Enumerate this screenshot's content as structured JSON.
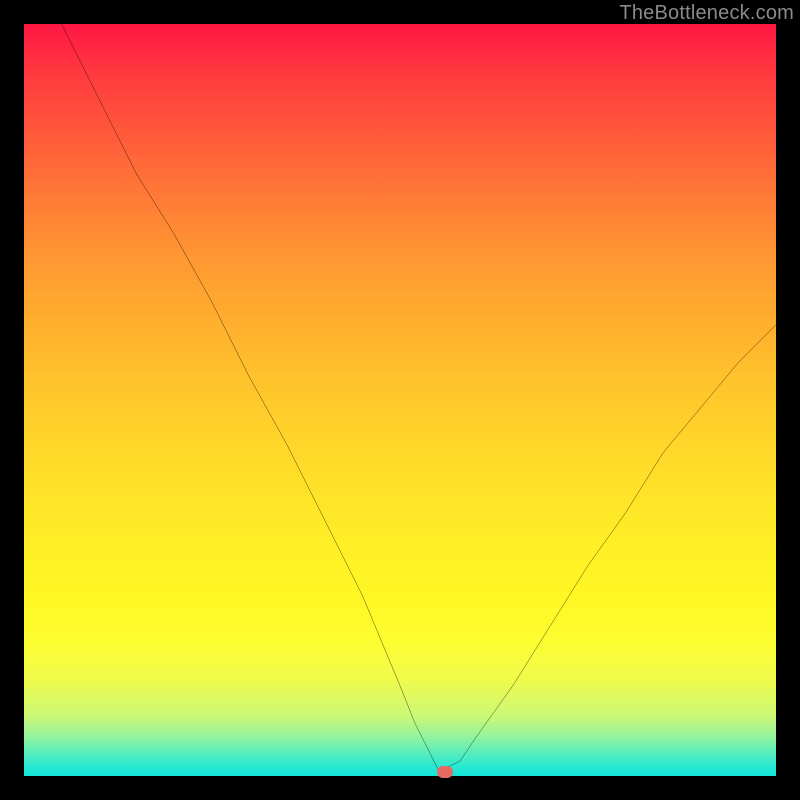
{
  "watermark": "TheBottleneck.com",
  "colors": {
    "background": "#000000",
    "curve_stroke": "#000000",
    "marker_fill": "#e46a62",
    "watermark_text": "#8a8a8a",
    "gradient_stops": [
      "#ff1744",
      "#ff3b3e",
      "#ff5b3a",
      "#ff7a36",
      "#ff9732",
      "#ffad2e",
      "#ffc22c",
      "#ffd42a",
      "#ffe228",
      "#ffee26",
      "#fff724",
      "#fdfd30",
      "#f0fb4a",
      "#ccf876",
      "#8ef3a1",
      "#55edbd",
      "#2de8cf",
      "#14e5d8"
    ]
  },
  "chart_data": {
    "type": "line",
    "title": "",
    "xlabel": "",
    "ylabel": "",
    "xlim": [
      0,
      100
    ],
    "ylim": [
      0,
      100
    ],
    "grid": false,
    "legend": "none",
    "series": [
      {
        "name": "bottleneck-curve",
        "x": [
          5,
          10,
          15,
          20,
          25,
          30,
          35,
          40,
          45,
          50,
          52,
          54,
          55,
          56,
          58,
          60,
          65,
          70,
          75,
          80,
          85,
          90,
          95,
          100
        ],
        "y": [
          100,
          90,
          80,
          72,
          63,
          53,
          44,
          34,
          24,
          12,
          7,
          3,
          1,
          1,
          2,
          5,
          12,
          20,
          28,
          35,
          43,
          49,
          55,
          60
        ]
      }
    ],
    "annotations": [
      {
        "name": "minimum-marker",
        "x": 56,
        "y": 0.5
      }
    ]
  }
}
